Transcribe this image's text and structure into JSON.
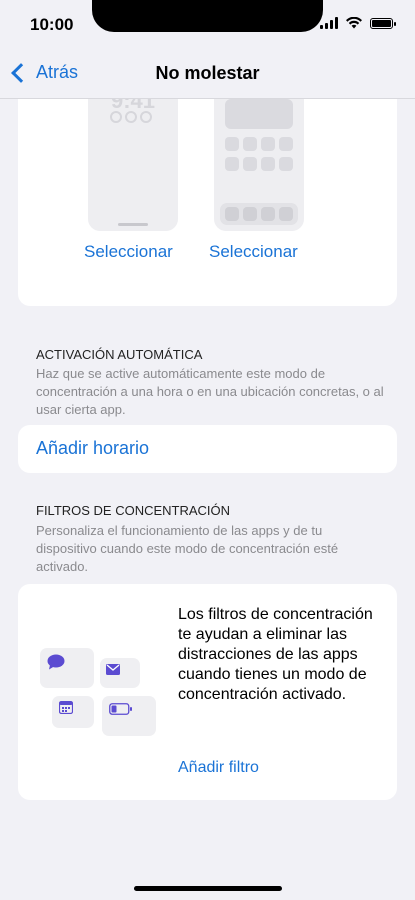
{
  "status": {
    "time": "10:00"
  },
  "nav": {
    "back_label": "Atrás",
    "title": "No molestar"
  },
  "preview": {
    "lock_time": "9:41",
    "select_lock": "Seleccionar",
    "select_home": "Seleccionar"
  },
  "auto": {
    "header": "ACTIVACIÓN AUTOMÁTICA",
    "description": "Haz que se active automáticamente este modo de concentración a una hora o en una ubicación concretas, o al usar cierta app.",
    "add_schedule": "Añadir horario"
  },
  "filters": {
    "header": "FILTROS DE CONCENTRACIÓN",
    "description": "Personaliza el funcionamiento de las apps y de tu dispositivo cuando este modo de concentración esté activado.",
    "info": "Los filtros de concentración te ayudan a eliminar las distracciones de las apps cuando tienes un modo de concentración activado.",
    "add_filter": "Añadir filtro"
  },
  "colors": {
    "accent": "#1a73d6",
    "icon_purple": "#5b4bd1"
  }
}
